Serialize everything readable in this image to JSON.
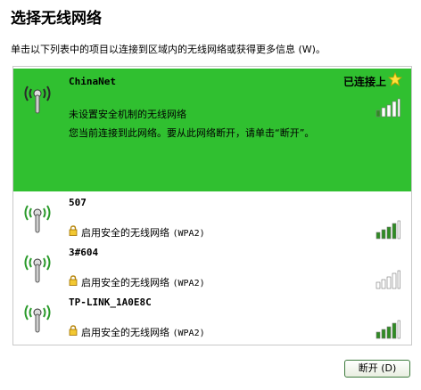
{
  "header": {
    "title": "选择无线网络",
    "subtitle": "单击以下列表中的项目以连接到区域内的无线网络或获得更多信息 (W)。"
  },
  "networks": [
    {
      "name": "ChinaNet",
      "status": "已连接上",
      "desc_line1": "未设置安全机制的无线网络",
      "desc_line2": "您当前连接到此网络。要从此网络断开，请单击“断开”。",
      "signal": 1,
      "secured": false,
      "selected": true
    },
    {
      "name": "507",
      "security": "启用安全的无线网络",
      "security_type": "(WPA2)",
      "signal": 4,
      "secured": true
    },
    {
      "name": "3#604",
      "security": "启用安全的无线网络",
      "security_type": "(WPA2)",
      "signal": 0,
      "secured": true
    },
    {
      "name": "TP-LINK_1A0E8C",
      "security": "启用安全的无线网络",
      "security_type": "(WPA2)",
      "signal": 4,
      "secured": true
    }
  ],
  "footer": {
    "disconnect_label": "断开 (D)"
  },
  "colors": {
    "selected_bg": "#30c030",
    "signal_on": "#3a9a2a",
    "signal_off": "#ffffff"
  }
}
